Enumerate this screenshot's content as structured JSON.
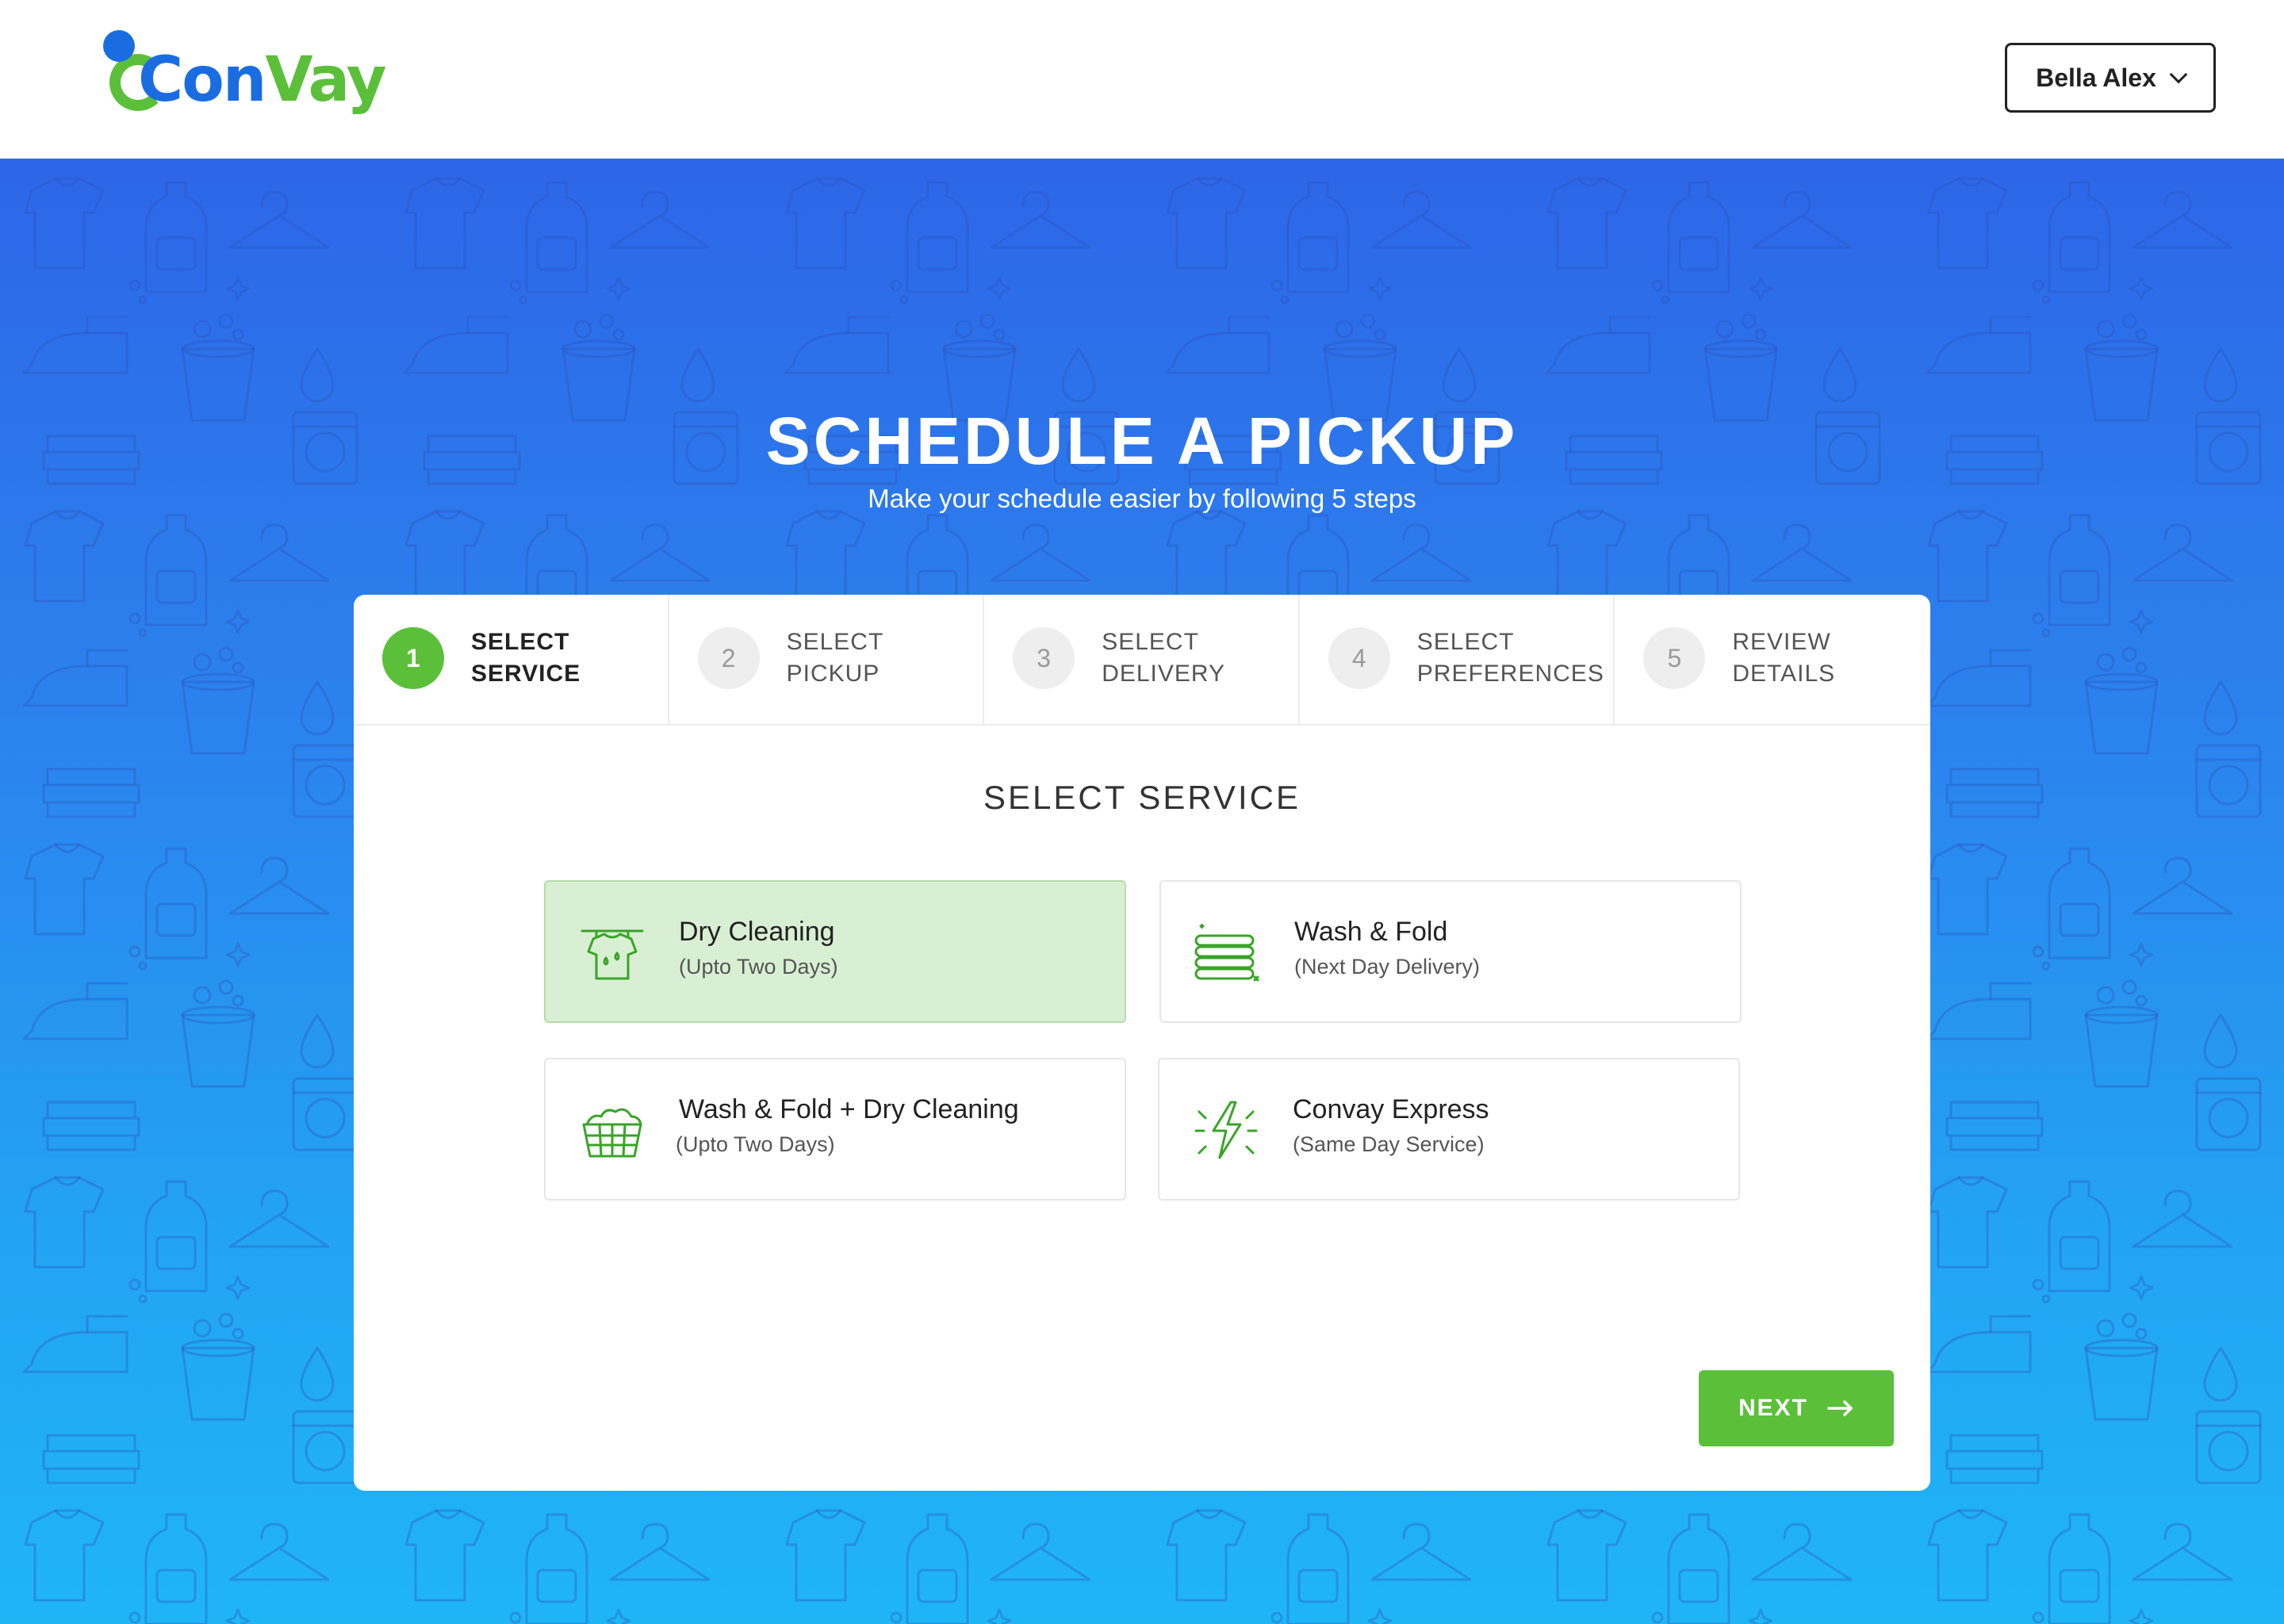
{
  "header": {
    "logo_part1": "Con",
    "logo_part2": "Vay",
    "user_name": "Bella Alex"
  },
  "hero": {
    "title": "SCHEDULE A PICKUP",
    "subtitle": "Make your schedule easier by following 5 steps"
  },
  "steps": [
    {
      "number": "1",
      "label": "SELECT\nSERVICE",
      "active": true
    },
    {
      "number": "2",
      "label": "SELECT\nPICKUP",
      "active": false
    },
    {
      "number": "3",
      "label": "SELECT\nDELIVERY",
      "active": false
    },
    {
      "number": "4",
      "label": "SELECT\nPREFERENCES",
      "active": false
    },
    {
      "number": "5",
      "label": "REVIEW\nDETAILS",
      "active": false
    }
  ],
  "section_title": "SELECT SERVICE",
  "services": [
    {
      "name": "Dry Cleaning",
      "detail": "(Upto Two Days)",
      "icon": "shirt-on-hanger-icon",
      "selected": true
    },
    {
      "name": "Wash & Fold",
      "detail": "(Next Day Delivery)",
      "icon": "folded-clothes-icon",
      "selected": false
    },
    {
      "name": "Wash & Fold + Dry Cleaning",
      "detail": "(Upto Two Days)",
      "icon": "laundry-basket-icon",
      "selected": false
    },
    {
      "name": "Convay Express",
      "detail": "(Same Day Service)",
      "icon": "lightning-bolt-icon",
      "selected": false
    }
  ],
  "next_button": {
    "label": "NEXT"
  },
  "colors": {
    "brand_blue": "#1a6de0",
    "brand_green": "#5bbf3a",
    "selected_bg": "#d9efd4",
    "hero_top": "#2d66e8",
    "hero_bottom": "#1fb5f5"
  }
}
